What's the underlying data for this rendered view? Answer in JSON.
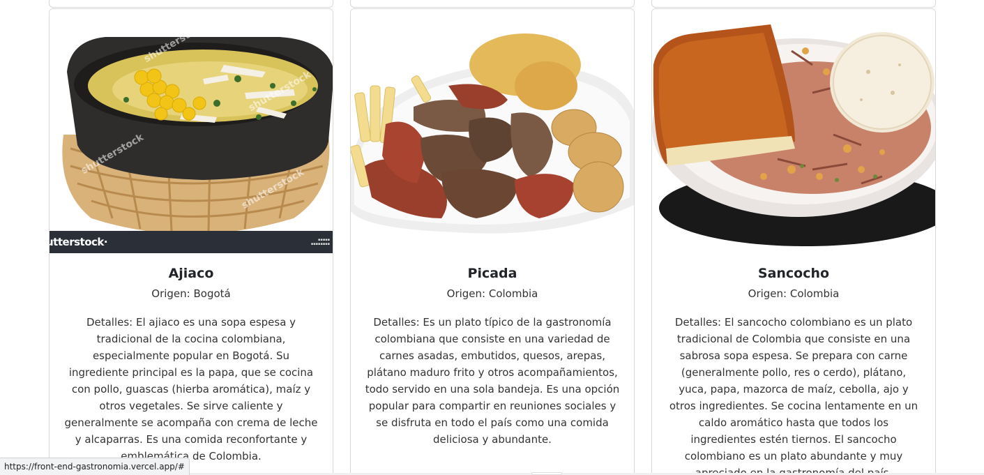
{
  "cards": [
    {
      "title": "Ajiaco",
      "origin": "Origen: Bogotá",
      "details": "Detalles: El ajiaco es una sopa espesa y tradicional de la cocina colombiana, especialmente popular en Bogotá. Su ingrediente principal es la papa, que se cocina con pollo, guascas (hierba aromática), maíz y otros vegetales. Se sirve caliente y generalmente se acompaña con crema de leche y alcaparras. Es una comida reconfortante y emblemática de Colombia.",
      "image_watermark": "shutterstock"
    },
    {
      "title": "Picada",
      "origin": "Origen: Colombia",
      "details": "Detalles: Es un plato típico de la gastronomía colombiana que consiste en una variedad de carnes asadas, embutidos, quesos, arepas, plátano maduro frito y otros acompañamientos, todo servido en una sola bandeja. Es una opción popular para compartir en reuniones sociales y se disfruta en todo el país como una comida deliciosa y abundante."
    },
    {
      "title": "Sancocho",
      "origin": "Origen: Colombia",
      "details": "Detalles: El sancocho colombiano es un plato tradicional de Colombia que consiste en una sabrosa sopa espesa. Se prepara con carne (generalmente pollo, res o cerdo), plátano, yuca, papa, mazorca de maíz, cebolla, ajo y otros ingredientes. Se cocina lentamente en un caldo aromático hasta que todos los ingredientes estén tiernos. El sancocho colombiano es un plato abundante y muy apreciado en la gastronomía del país."
    }
  ],
  "status_bar": {
    "url": "https://front-end-gastronomia.vercel.app/#"
  },
  "colors": {
    "card_border": "#d8d8d8",
    "stock_bar": "#2b3038"
  }
}
